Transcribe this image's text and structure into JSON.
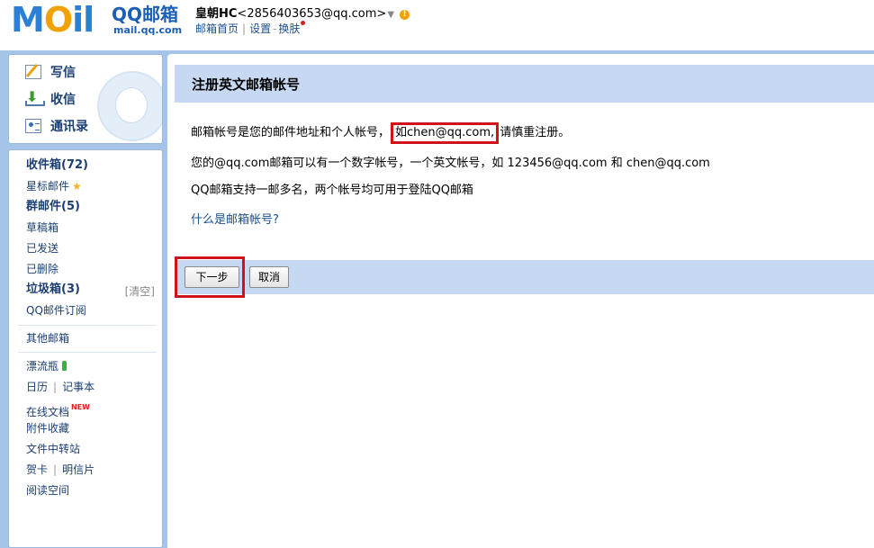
{
  "logo": {
    "word_m": "M",
    "word_o": "O",
    "word_il": "il",
    "brand": "QQ邮箱",
    "domain": "mail.qq.com"
  },
  "user": {
    "name": "皇朝HC",
    "email": "<2856403653@qq.com>",
    "dropdown": "▼",
    "warn": "!"
  },
  "toplinks": {
    "home": "邮箱首页",
    "sep": "|",
    "settings": "设置",
    "dash": "-",
    "skin": "换肤"
  },
  "quick": {
    "write": "写信",
    "receive": "收信",
    "contacts": "通讯录"
  },
  "folders": {
    "inbox": "收件箱(72)",
    "starred": "星标邮件",
    "star": "★",
    "group": "群邮件(5)",
    "drafts": "草稿箱",
    "sent": "已发送",
    "deleted": "已删除",
    "spam": "垃圾箱(3)",
    "clear": "[清空]",
    "subscriptions": "QQ邮件订阅",
    "other": "其他邮箱",
    "drift": "漂流瓶",
    "calendar": "日历",
    "pipe": "|",
    "notes": "记事本",
    "docs": "在线文档",
    "new_badge": "NEW",
    "attachments": "附件收藏",
    "transfer": "文件中转站",
    "cards": "贺卡",
    "postcards": "明信片",
    "reading": "阅读空间"
  },
  "main": {
    "title": "注册英文邮箱帐号",
    "line1_before": "邮箱帐号是您的邮件地址和个人帐号，",
    "line1_highlight": "如chen@qq.com,",
    "line1_after": "请慎重注册。",
    "line2": "您的@qq.com邮箱可以有一个数字帐号，一个英文帐号，如 123456@qq.com 和 chen@qq.com",
    "line3": "QQ邮箱支持一邮多名，两个帐号均可用于登陆QQ邮箱",
    "help_link": "什么是邮箱帐号?",
    "next_button": "下一步",
    "cancel_button": "取消"
  },
  "colors": {
    "frame_blue": "#a6c4e8",
    "title_bar": "#c7d9f2",
    "link_blue": "#1b4f8f",
    "highlight_red": "#d0121b"
  }
}
